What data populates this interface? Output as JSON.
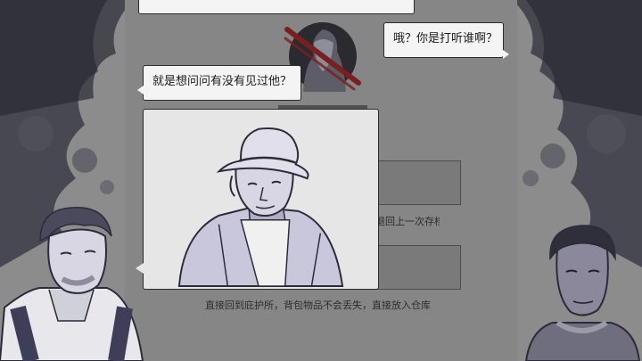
{
  "dialogue": {
    "top_bubble_text": "",
    "right_bubble_text": "哦？你是打听谁啊？",
    "left_bubble_text": "就是想问问有没有见过他？"
  },
  "menu": {
    "caption_1": "退回上一次存档",
    "caption_2": "直接回到庇护所，背包物品不会丢失，直接放入仓库"
  },
  "icons": {
    "emblem": "crossed-out-portrait-icon",
    "portrait": "man-in-hat-sketch"
  },
  "colors": {
    "background": "#8c8c8c",
    "ink": "#3a3a48",
    "bubble": "#f4f4f4",
    "emblem_red": "#7a1f1f"
  }
}
